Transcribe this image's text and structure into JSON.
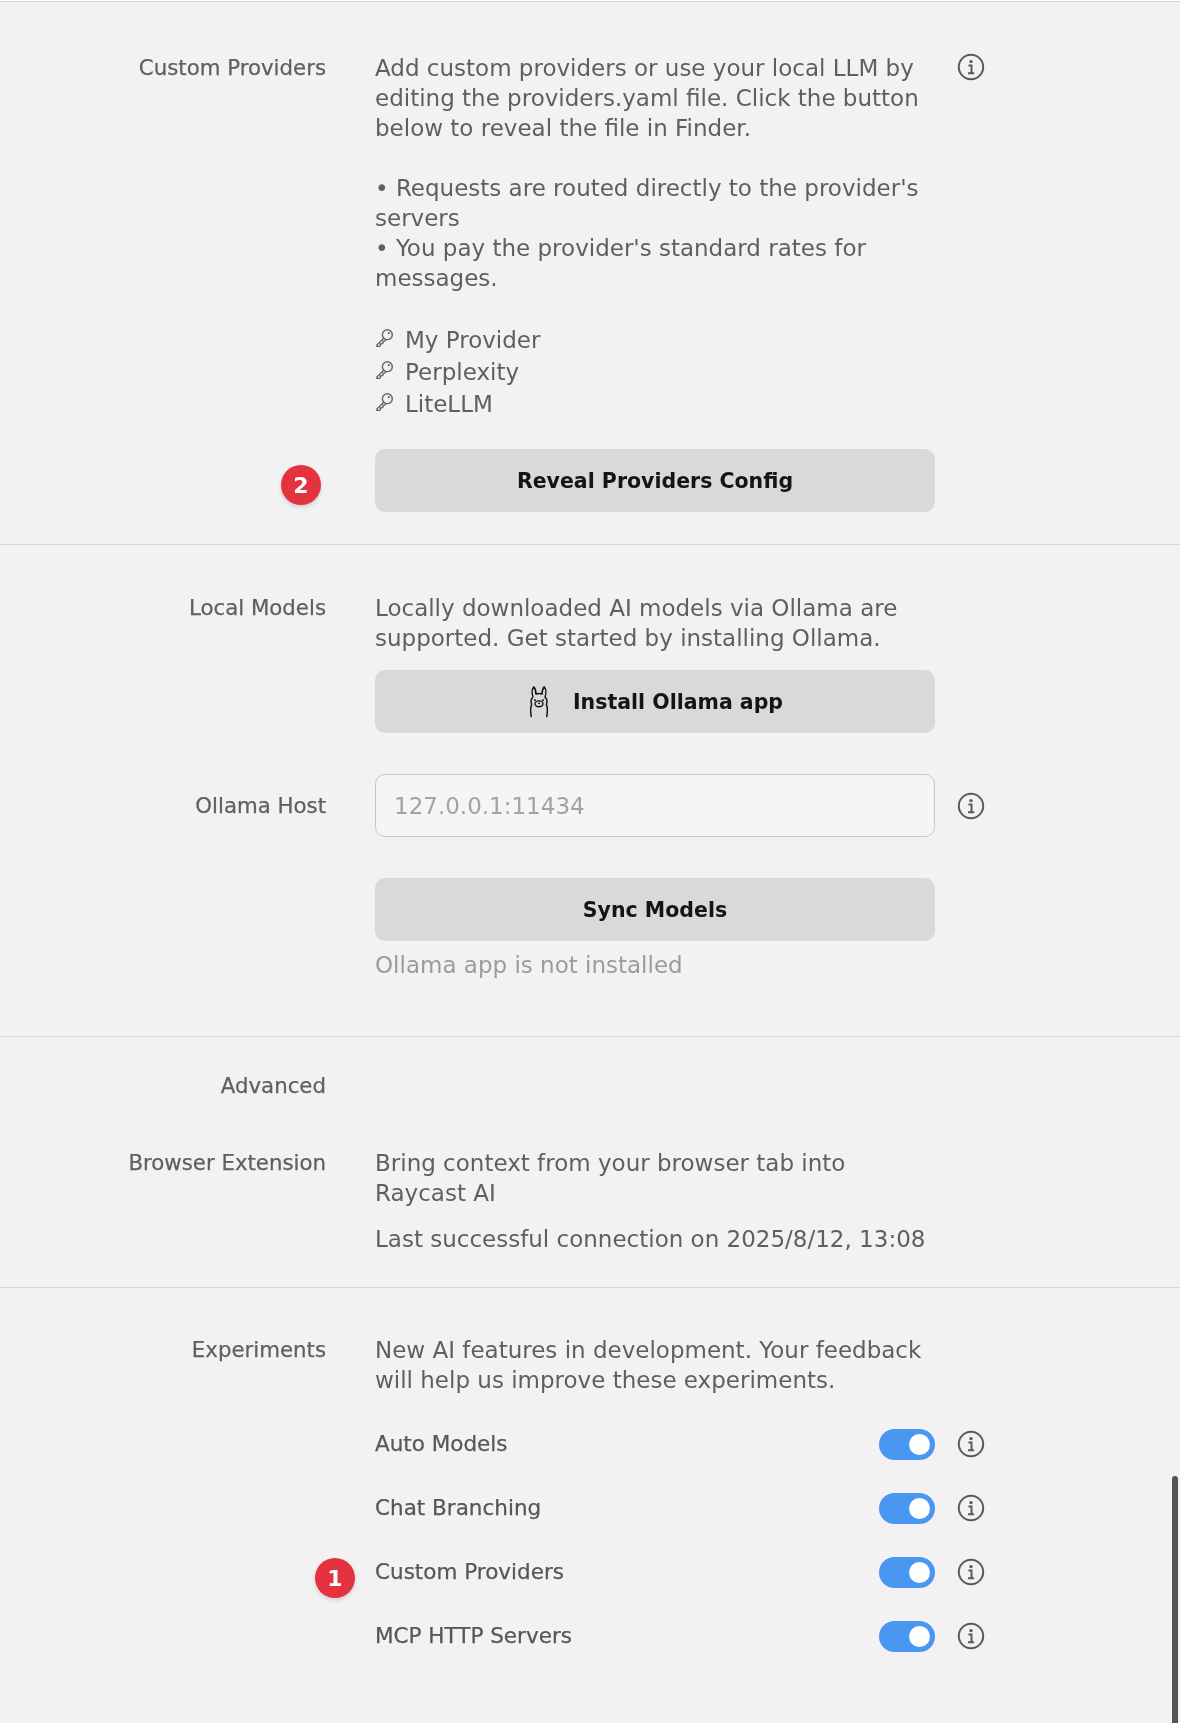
{
  "custom_providers": {
    "label": "Custom Providers",
    "description": "Add custom providers or use your local LLM by editing the providers.yaml file. Click the button below to reveal the file in Finder.",
    "bullets": [
      "• Requests are routed directly to the provider's servers",
      "• You pay the provider's standard rates for messages."
    ],
    "providers": [
      "My Provider",
      "Perplexity",
      "LiteLLM"
    ],
    "button": "Reveal Providers Config",
    "marker": "2"
  },
  "local_models": {
    "label": "Local Models",
    "description": "Locally downloaded AI models via Ollama are supported. Get started by installing Ollama.",
    "button": "Install Ollama app"
  },
  "ollama_host": {
    "label": "Ollama Host",
    "placeholder": "127.0.0.1:11434",
    "button": "Sync Models",
    "status": "Ollama app is not installed"
  },
  "advanced": {
    "label": "Advanced"
  },
  "browser_extension": {
    "label": "Browser Extension",
    "description": "Bring context from your browser tab into Raycast AI",
    "last_connection": "Last successful connection on 2025/8/12, 13:08"
  },
  "experiments": {
    "label": "Experiments",
    "description": "New AI features in development. Your feedback will help us improve these experiments.",
    "items": [
      {
        "label": "Auto Models",
        "on": true
      },
      {
        "label": "Chat Branching",
        "on": true
      },
      {
        "label": "Custom Providers",
        "on": true,
        "marker": "1"
      },
      {
        "label": "MCP HTTP Servers",
        "on": true
      }
    ]
  }
}
